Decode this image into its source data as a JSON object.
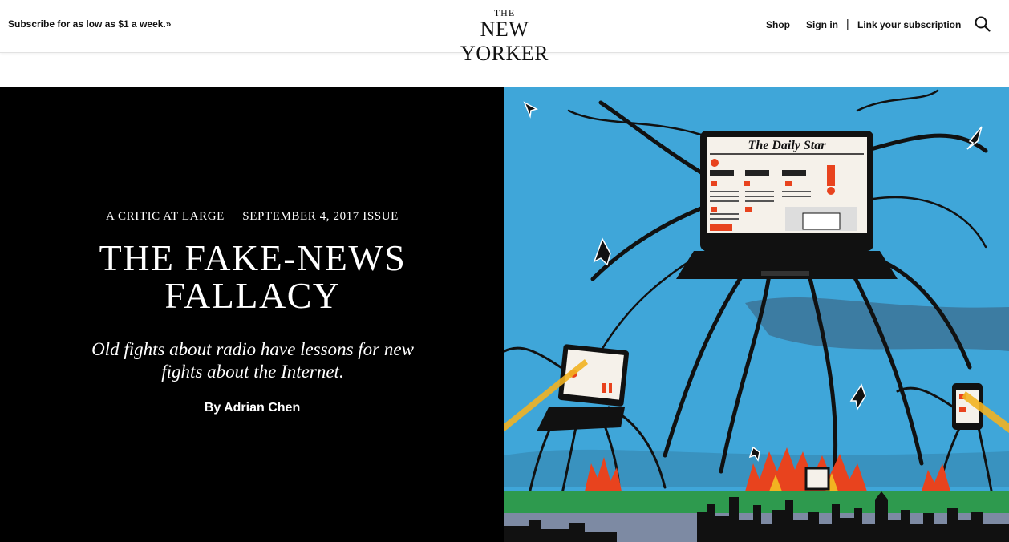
{
  "nav": {
    "subscribe": "Subscribe for as low as $1 a week.»",
    "logo_the": "THE",
    "logo_main": "NEW YORKER",
    "shop": "Shop",
    "sign_in": "Sign in",
    "separator": "|",
    "link_subscription": "Link your subscription",
    "search_icon": "search-icon"
  },
  "article": {
    "rubric": "A CRITIC AT LARGE",
    "issue": "SEPTEMBER 4, 2017 ISSUE",
    "headline": "THE FAKE-NEWS FALLACY",
    "dek": "Old fights about radio have lessons for new fights about the Internet.",
    "byline_prefix": "By",
    "author": "Adrian Chen"
  },
  "illustration": {
    "newspaper_masthead": "The Daily Star",
    "colors": {
      "sky": "#3fa6d9",
      "ground": "#2e9a4e",
      "fire": "#e8431e",
      "black": "#111111"
    }
  }
}
